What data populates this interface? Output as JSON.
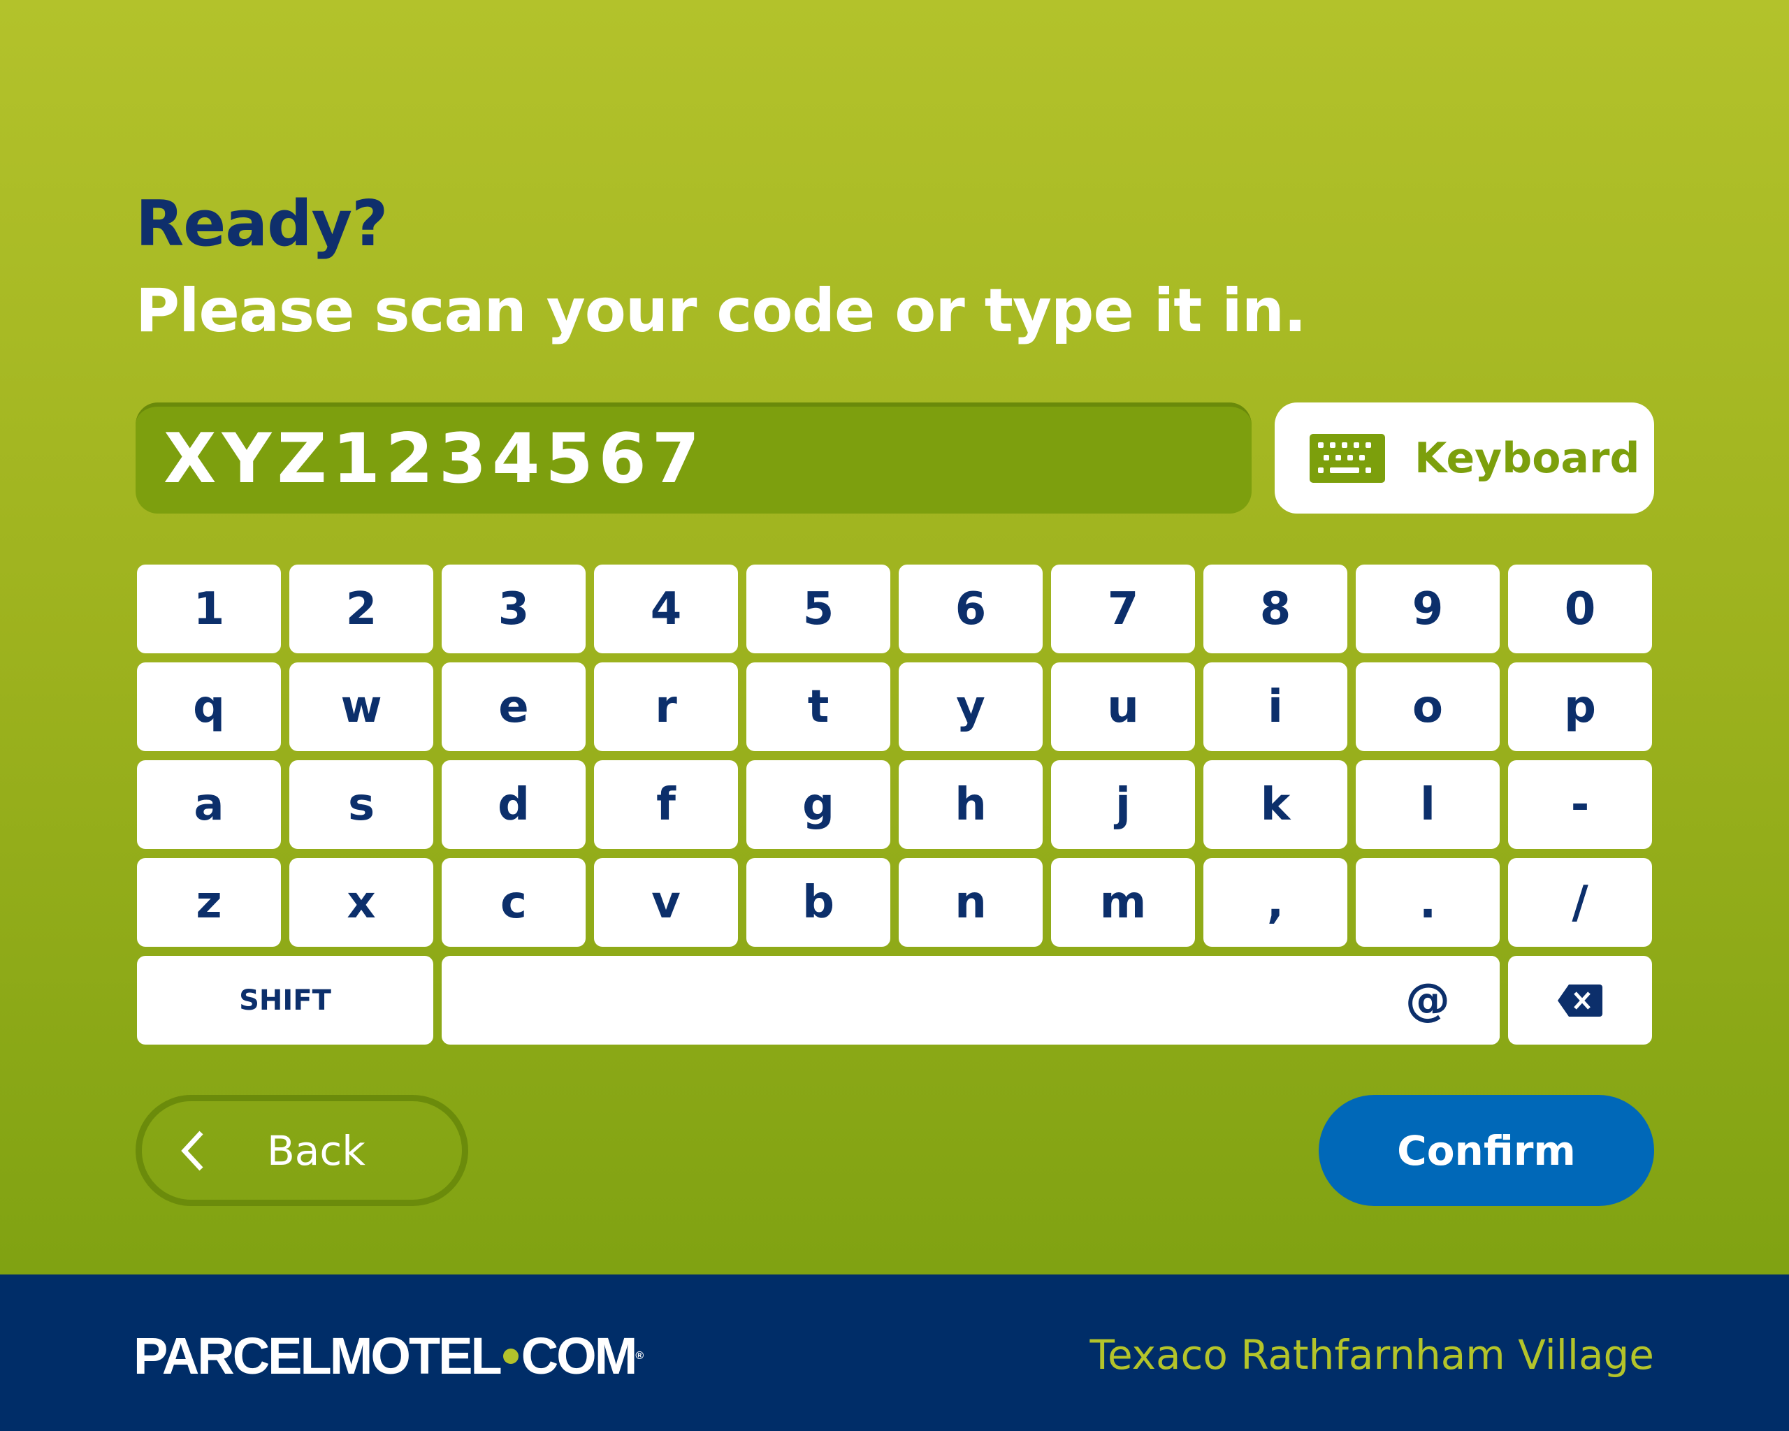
{
  "header": {
    "title": "Ready?",
    "subtitle": "Please scan your code or type it in."
  },
  "code_input": {
    "value": "XYZ1234567"
  },
  "keyboard_button": {
    "label": "Keyboard",
    "icon": "keyboard-icon"
  },
  "keyboard": {
    "rows": [
      [
        "1",
        "2",
        "3",
        "4",
        "5",
        "6",
        "7",
        "8",
        "9",
        "0"
      ],
      [
        "q",
        "w",
        "e",
        "r",
        "t",
        "y",
        "u",
        "i",
        "o",
        "p"
      ],
      [
        "a",
        "s",
        "d",
        "f",
        "g",
        "h",
        "j",
        "k",
        "l",
        "-"
      ],
      [
        "z",
        "x",
        "c",
        "v",
        "b",
        "n",
        "m",
        ",",
        ".",
        "/"
      ]
    ],
    "shift_label": "SHIFT",
    "space_label": "",
    "at_label": "@",
    "backspace_icon": "backspace-icon"
  },
  "actions": {
    "back_label": "Back",
    "confirm_label": "Confirm"
  },
  "footer": {
    "logo_text": "PARCELMOTEL·COM",
    "location": "Texaco Rathfarnham Village"
  },
  "colors": {
    "green_top": "#b3c22b",
    "green_bottom": "#80a212",
    "navy": "#002d68",
    "blue": "#0068b8",
    "key_text": "#0c2f6b"
  }
}
